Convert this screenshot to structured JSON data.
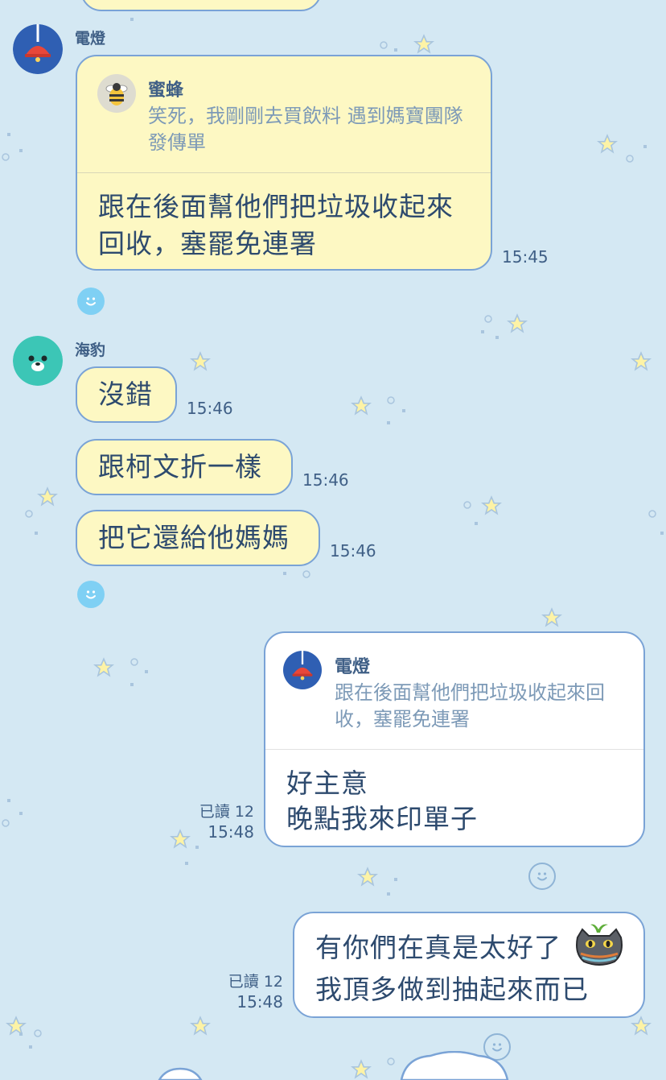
{
  "messages": {
    "m1": {
      "sender": "電燈",
      "reply_name": "蜜蜂",
      "reply_text": "笑死，我剛剛去買飲料 遇到媽寶團隊發傳單",
      "text": "跟在後面幫他們把垃圾收起來回收，塞罷免連署",
      "time": "15:45"
    },
    "m2": {
      "sender": "海豹",
      "text": "沒錯",
      "time": "15:46"
    },
    "m3": {
      "text": "跟柯文折一樣",
      "time": "15:46"
    },
    "m4": {
      "text": "把它還給他媽媽",
      "time": "15:46"
    },
    "m5": {
      "reply_name": "電燈",
      "reply_text": "跟在後面幫他們把垃圾收起來回收，塞罷免連署",
      "line1": "好主意",
      "line2": "晚點我來印單子",
      "read": "已讀 12",
      "time": "15:48"
    },
    "m6": {
      "line1": "有你們在真是太好了",
      "line2": "我頂多做到抽起來而已",
      "read": "已讀 12",
      "time": "15:48"
    }
  },
  "icons": {
    "lamp_avatar": "lamp-avatar-icon",
    "bee_avatar": "bee-avatar-icon",
    "seal_avatar": "seal-avatar-icon",
    "smile": "smile-icon",
    "cat_sticker": "cat-sprout-emoji"
  },
  "colors": {
    "background": "#d4e8f3",
    "bubble_yellow": "#fdf8c3",
    "bubble_white": "#ffffff",
    "border": "#7aa3d6",
    "text": "#2d4a6e",
    "reply_text": "#7d9ab7"
  }
}
